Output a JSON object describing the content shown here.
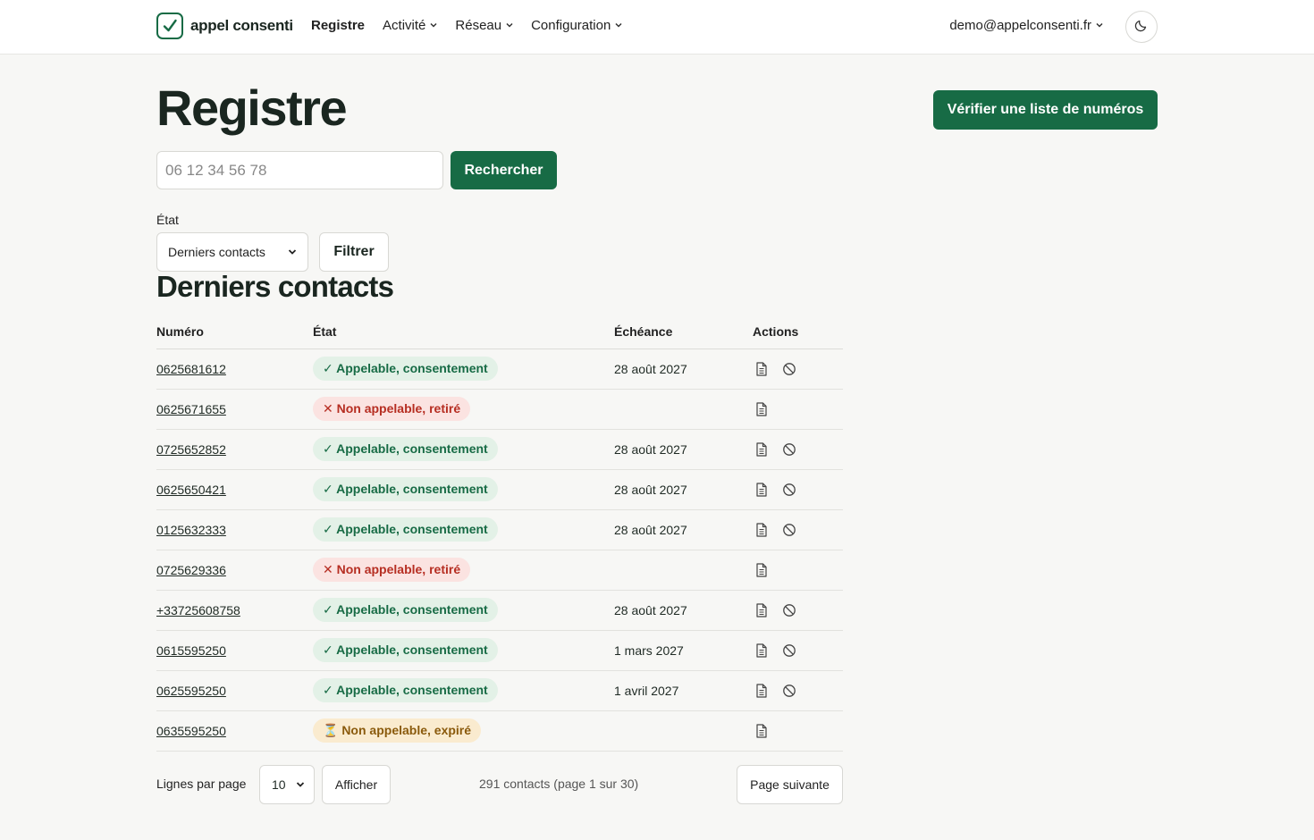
{
  "header": {
    "brand": "appel consenti",
    "nav": [
      {
        "label": "Registre",
        "active": true,
        "dropdown": false
      },
      {
        "label": "Activité",
        "active": false,
        "dropdown": true
      },
      {
        "label": "Réseau",
        "active": false,
        "dropdown": true
      },
      {
        "label": "Configuration",
        "active": false,
        "dropdown": true
      }
    ],
    "user": "demo@appelconsenti.fr",
    "theme_icon": "moon-icon"
  },
  "page": {
    "title": "Registre",
    "verify_label": "Vérifier une liste de numéros"
  },
  "search": {
    "placeholder": "06 12 34 56 78",
    "button": "Rechercher"
  },
  "filter": {
    "label": "État",
    "selected": "Derniers contacts",
    "button": "Filtrer"
  },
  "section_title": "Derniers contacts",
  "table": {
    "headers": [
      "Numéro",
      "État",
      "Échéance",
      "Actions"
    ],
    "rows": [
      {
        "number": "0625681612",
        "status": "✓ Appelable, consentement",
        "kind": "ok",
        "due": "28 août 2027"
      },
      {
        "number": "0625671655",
        "status": "✕ Non appelable, retiré",
        "kind": "ko",
        "due": ""
      },
      {
        "number": "0725652852",
        "status": "✓ Appelable, consentement",
        "kind": "ok",
        "due": "28 août 2027"
      },
      {
        "number": "0625650421",
        "status": "✓ Appelable, consentement",
        "kind": "ok",
        "due": "28 août 2027"
      },
      {
        "number": "0125632333",
        "status": "✓ Appelable, consentement",
        "kind": "ok",
        "due": "28 août 2027"
      },
      {
        "number": "0725629336",
        "status": "✕ Non appelable, retiré",
        "kind": "ko",
        "due": ""
      },
      {
        "number": "+33725608758",
        "status": "✓ Appelable, consentement",
        "kind": "ok",
        "due": "28 août 2027"
      },
      {
        "number": "0615595250",
        "status": "✓ Appelable, consentement",
        "kind": "ok",
        "due": "1 mars 2027"
      },
      {
        "number": "0625595250",
        "status": "✓ Appelable, consentement",
        "kind": "ok",
        "due": "1 avril 2027"
      },
      {
        "number": "0635595250",
        "status": "⏳ Non appelable, expiré",
        "kind": "exp",
        "due": ""
      }
    ]
  },
  "pagination": {
    "lines_label": "Lignes par page",
    "lines_value": "10",
    "show_button": "Afficher",
    "info": "291 contacts (page 1 sur 30)",
    "next_button": "Page suivante"
  },
  "colors": {
    "brand": "#176b45",
    "ok_bg": "#e3f1e7",
    "ko_bg": "#fbe3e1",
    "ko_fg": "#b62e22",
    "exp_bg": "#faebcf"
  }
}
